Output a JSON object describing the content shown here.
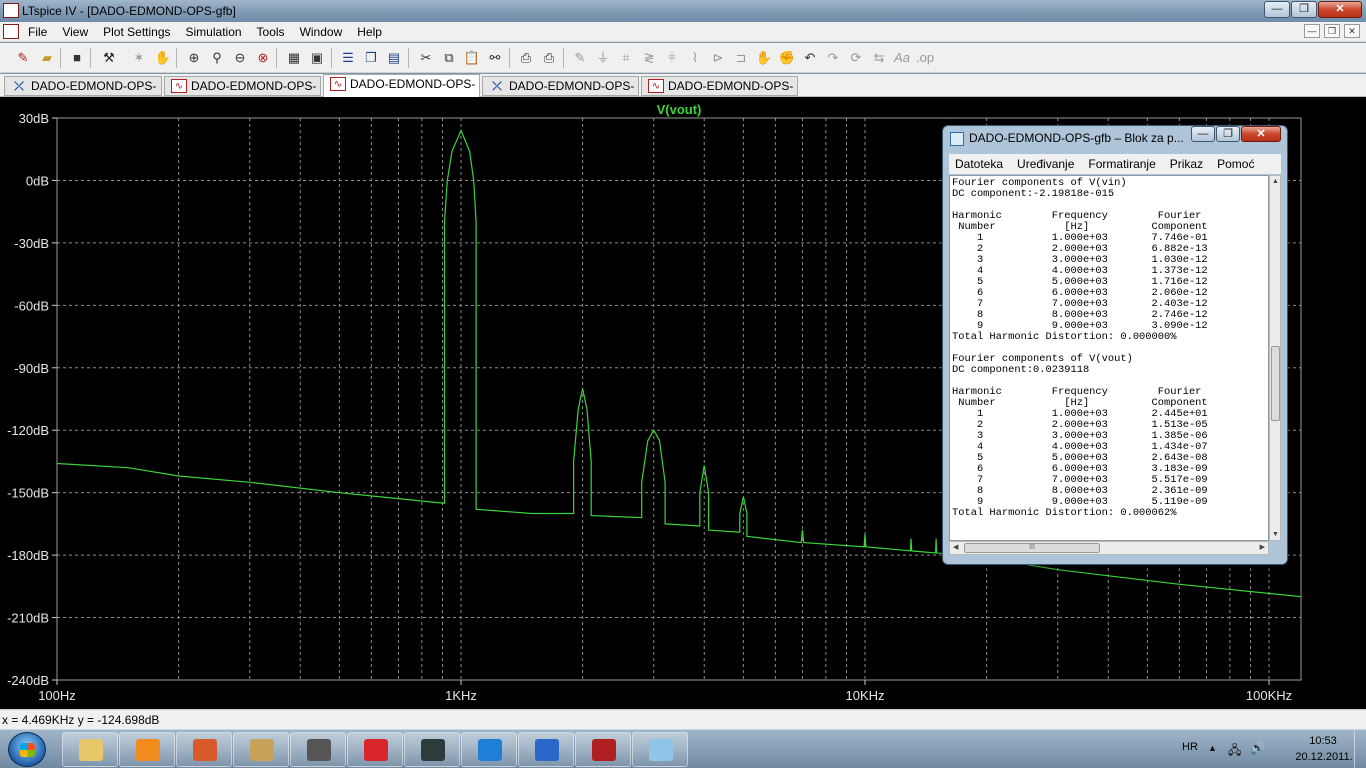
{
  "window": {
    "title": "LTspice IV - [DADO-EDMOND-OPS-gfb]",
    "minimize": "—",
    "maximize": "❐",
    "close": "✕"
  },
  "menu": {
    "items": [
      "File",
      "View",
      "Plot Settings",
      "Simulation",
      "Tools",
      "Window",
      "Help"
    ],
    "mdi_buttons": [
      "—",
      "❐",
      "✕"
    ]
  },
  "toolbar": {
    "icons": [
      "new-schematic-icon",
      "open-icon",
      "save-icon",
      "control-panel-icon",
      "run-icon",
      "halt-icon",
      "zoom-in-icon",
      "zoom-area-icon",
      "zoom-out-icon",
      "zoom-cancel-icon",
      "autoscale-icon",
      "fit-icon",
      "tile-horizontal-icon",
      "cascade-icon",
      "close-window-icon",
      "cut-icon",
      "copy-icon",
      "paste-icon",
      "find-icon",
      "print-preview-icon",
      "print-icon",
      "wire-icon",
      "ground-icon",
      "label-icon",
      "resistor-icon",
      "capacitor-icon",
      "inductor-icon",
      "diode-icon",
      "component-icon",
      "move-icon",
      "drag-icon",
      "undo-icon",
      "redo-icon",
      "rotate-icon",
      "mirror-icon",
      "text-icon",
      "spice-directive-icon"
    ]
  },
  "tabs": [
    {
      "label": "DADO-EDMOND-OPS-gfb",
      "kind": "schematic"
    },
    {
      "label": "DADO-EDMOND-OPS-gfb",
      "kind": "waveform"
    },
    {
      "label": "DADO-EDMOND-OPS-gfb",
      "kind": "waveform",
      "active": true
    },
    {
      "label": "DADO-EDMOND-OPS-pfb",
      "kind": "schematic"
    },
    {
      "label": "DADO-EDMOND-OPS-pfb",
      "kind": "waveform"
    }
  ],
  "chart_data": {
    "type": "line",
    "title": "V(vout)",
    "x_scale": "log",
    "xlim": [
      100,
      120000
    ],
    "ylim": [
      -240,
      30
    ],
    "x_ticks": [
      {
        "value": 100,
        "label": "100Hz"
      },
      {
        "value": 1000,
        "label": "1KHz"
      },
      {
        "value": 10000,
        "label": "10KHz"
      },
      {
        "value": 100000,
        "label": "100KHz"
      }
    ],
    "y_ticks": [
      {
        "value": 30,
        "label": "30dB"
      },
      {
        "value": 0,
        "label": "0dB"
      },
      {
        "value": -30,
        "label": "-30dB"
      },
      {
        "value": -60,
        "label": "-60dB"
      },
      {
        "value": -90,
        "label": "-90dB"
      },
      {
        "value": -120,
        "label": "-120dB"
      },
      {
        "value": -150,
        "label": "-150dB"
      },
      {
        "value": -180,
        "label": "-180dB"
      },
      {
        "value": -210,
        "label": "-210dB"
      },
      {
        "value": -240,
        "label": "-240dB"
      }
    ],
    "grid": true,
    "series": [
      {
        "name": "V(vout)",
        "color": "#3cd43c",
        "points": [
          [
            100,
            -136
          ],
          [
            150,
            -138
          ],
          [
            200,
            -142
          ],
          [
            300,
            -145
          ],
          [
            500,
            -150
          ],
          [
            900,
            -155
          ],
          [
            910,
            -155
          ],
          [
            910,
            -20
          ],
          [
            925,
            0
          ],
          [
            950,
            14
          ],
          [
            1000,
            24
          ],
          [
            1050,
            14
          ],
          [
            1075,
            0
          ],
          [
            1090,
            -20
          ],
          [
            1090,
            -158
          ],
          [
            1500,
            -160
          ],
          [
            1900,
            -160
          ],
          [
            1900,
            -135
          ],
          [
            1950,
            -110
          ],
          [
            2000,
            -100
          ],
          [
            2050,
            -110
          ],
          [
            2100,
            -135
          ],
          [
            2100,
            -161
          ],
          [
            2800,
            -162
          ],
          [
            2800,
            -145
          ],
          [
            2900,
            -125
          ],
          [
            3000,
            -120
          ],
          [
            3100,
            -125
          ],
          [
            3200,
            -145
          ],
          [
            3200,
            -165
          ],
          [
            3900,
            -166
          ],
          [
            3900,
            -150
          ],
          [
            4000,
            -137
          ],
          [
            4100,
            -150
          ],
          [
            4100,
            -168
          ],
          [
            4900,
            -169
          ],
          [
            4900,
            -160
          ],
          [
            5000,
            -152
          ],
          [
            5100,
            -160
          ],
          [
            5100,
            -171
          ],
          [
            6950,
            -174
          ],
          [
            7000,
            -168
          ],
          [
            7050,
            -174
          ],
          [
            9950,
            -176
          ],
          [
            10000,
            -170
          ],
          [
            10050,
            -176
          ],
          [
            12950,
            -178
          ],
          [
            13000,
            -172
          ],
          [
            13050,
            -178
          ],
          [
            14950,
            -179
          ],
          [
            15000,
            -172
          ],
          [
            15050,
            -179
          ],
          [
            17950,
            -180
          ],
          [
            18000,
            -174
          ],
          [
            18050,
            -180
          ],
          [
            30000,
            -187
          ],
          [
            60000,
            -194
          ],
          [
            120000,
            -200
          ]
        ]
      }
    ]
  },
  "status": {
    "cursor": "x = 4.469KHz   y = -124.698dB"
  },
  "notepad": {
    "title": "DADO-EDMOND-OPS-gfb – Blok za p...",
    "menu": [
      "Datoteka",
      "Uređivanje",
      "Formatiranje",
      "Prikaz",
      "Pomoć"
    ],
    "lines": [
      "Fourier components of V(vin)",
      "DC component:-2.19818e-015",
      "",
      "Harmonic        Frequency        Fourier",
      " Number           [Hz]          Component",
      "    1           1.000e+03       7.746e-01",
      "    2           2.000e+03       6.882e-13",
      "    3           3.000e+03       1.030e-12",
      "    4           4.000e+03       1.373e-12",
      "    5           5.000e+03       1.716e-12",
      "    6           6.000e+03       2.060e-12",
      "    7           7.000e+03       2.403e-12",
      "    8           8.000e+03       2.746e-12",
      "    9           9.000e+03       3.090e-12",
      "Total Harmonic Distortion: 0.000000%",
      "",
      "Fourier components of V(vout)",
      "DC component:0.0239118",
      "",
      "Harmonic        Frequency        Fourier",
      " Number           [Hz]          Component",
      "    1           1.000e+03       2.445e+01",
      "    2           2.000e+03       1.513e-05",
      "    3           3.000e+03       1.385e-06",
      "    4           4.000e+03       1.434e-07",
      "    5           5.000e+03       2.643e-08",
      "    6           6.000e+03       3.183e-09",
      "    7           7.000e+03       5.517e-09",
      "    8           8.000e+03       2.361e-09",
      "    9           9.000e+03       5.119e-09",
      "Total Harmonic Distortion: 0.000062%"
    ],
    "minimize": "—",
    "maximize": "❐",
    "close": "✕",
    "scroll_thumb_grip": "III"
  },
  "taskbar": {
    "apps": [
      {
        "name": "explorer",
        "color": "#e8c66a"
      },
      {
        "name": "media-player",
        "color": "#f28b1e"
      },
      {
        "name": "office",
        "color": "#d85a2a"
      },
      {
        "name": "network",
        "color": "#c9a25a"
      },
      {
        "name": "tool",
        "color": "#555555"
      },
      {
        "name": "antivirus",
        "color": "#d8262a"
      },
      {
        "name": "oscilloscope",
        "color": "#2f3a3a"
      },
      {
        "name": "internet-explorer",
        "color": "#1f7fd6"
      },
      {
        "name": "firefox",
        "color": "#2b67c8"
      },
      {
        "name": "ltspice",
        "color": "#b02020"
      },
      {
        "name": "notepad",
        "color": "#8fc6e8"
      }
    ],
    "lang": "HR",
    "time": "10:53",
    "date": "20.12.2011."
  }
}
